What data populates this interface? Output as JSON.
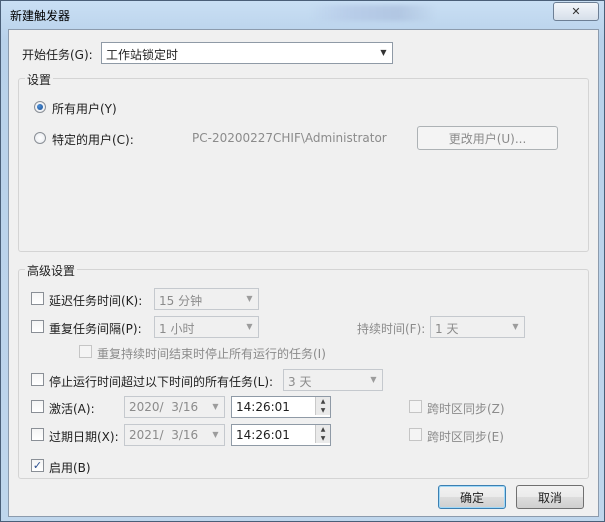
{
  "window": {
    "title": "新建触发器",
    "close_glyph": "✕"
  },
  "start_task": {
    "label": "开始任务(G):",
    "value": "工作站锁定时"
  },
  "settings": {
    "title": "设置",
    "all_users": "所有用户(Y)",
    "specific_user": "特定的用户(C):",
    "user_value": "PC-20200227CHIF\\Administrator",
    "change_user_button": "更改用户(U)..."
  },
  "advanced": {
    "title": "高级设置",
    "delay": {
      "label": "延迟任务时间(K):",
      "value": "15 分钟"
    },
    "repeat": {
      "label": "重复任务间隔(P):",
      "value": "1 小时",
      "duration_label": "持续时间(F):",
      "duration_value": "1 天"
    },
    "stop_running": "重复持续时间结束时停止所有运行的任务(I)",
    "stop_longer": {
      "label": "停止运行时间超过以下时间的所有任务(L):",
      "value": "3 天"
    },
    "activate": {
      "label": "激活(A):",
      "date": "2020/  3/16",
      "time": "14:26:01",
      "sync": "跨时区同步(Z)"
    },
    "expire": {
      "label": "过期日期(X):",
      "date": "2021/  3/16",
      "time": "14:26:01",
      "sync": "跨时区同步(E)"
    },
    "enabled": {
      "label": "启用(B)",
      "checked": true,
      "check_glyph": "✓"
    }
  },
  "buttons": {
    "ok": "确定",
    "cancel": "取消"
  },
  "icons": {
    "arrow": "▼",
    "spin_up": "▲",
    "spin_down": "▼"
  }
}
